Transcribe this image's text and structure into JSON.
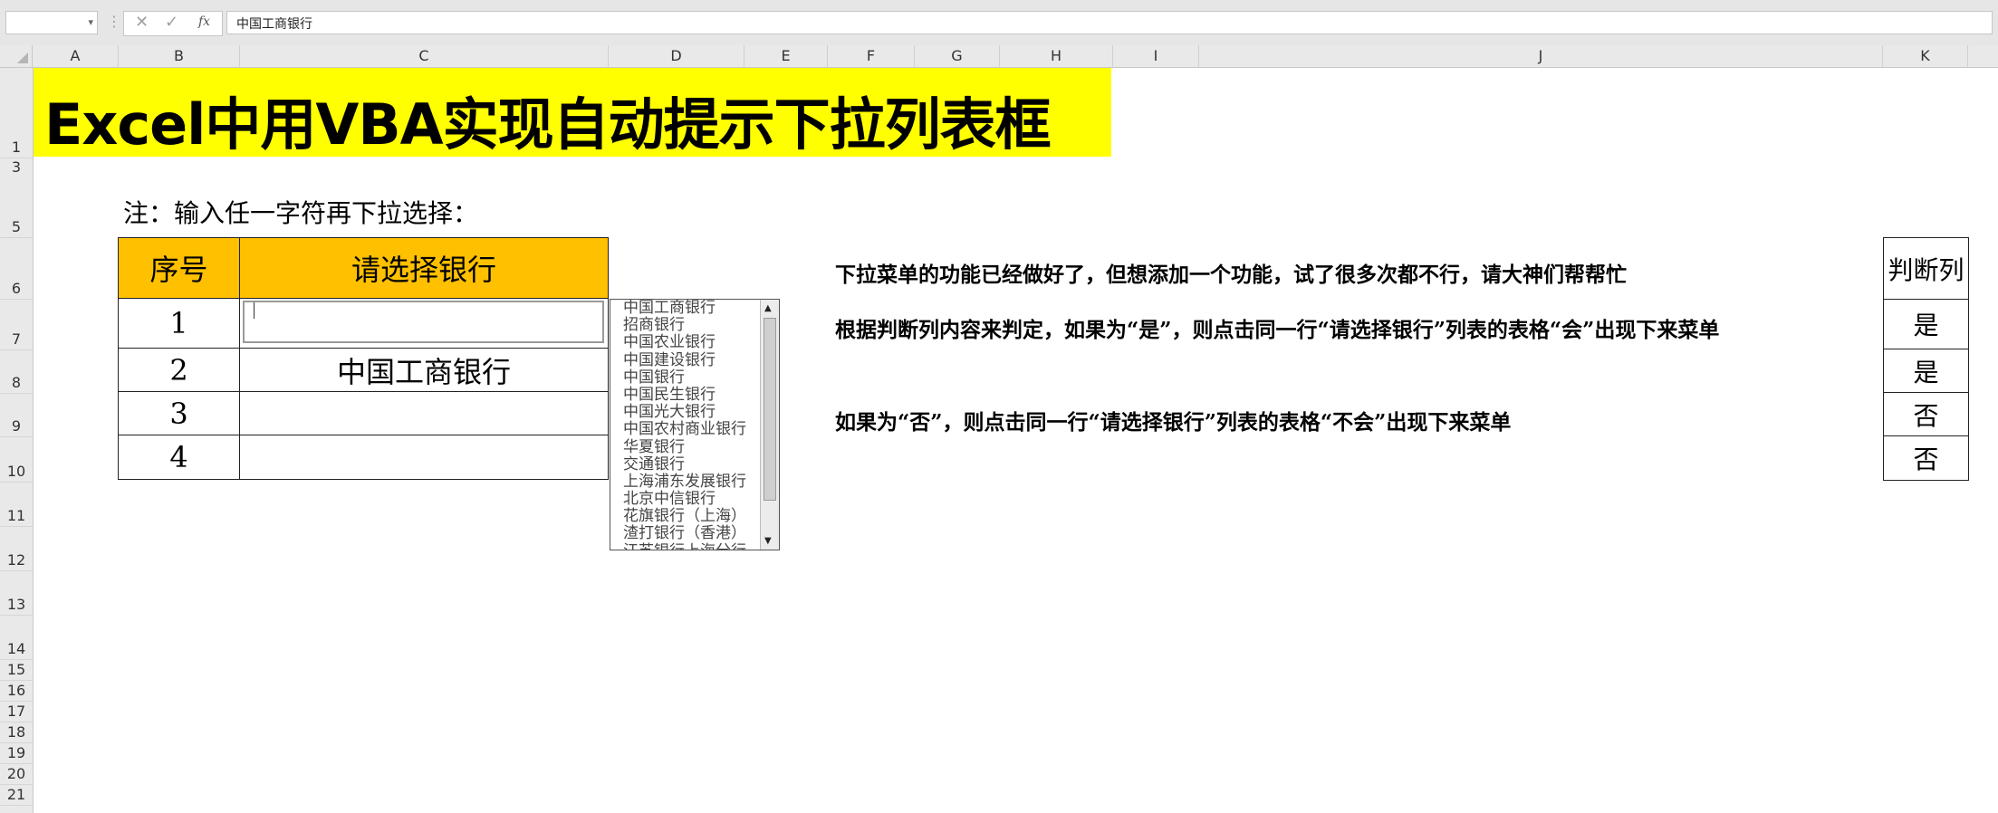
{
  "formula_bar": {
    "name_box": "",
    "fx_label": "fx",
    "formula": "中国工商银行"
  },
  "columns": [
    "A",
    "B",
    "C",
    "D",
    "E",
    "F",
    "G",
    "H",
    "I",
    "J",
    "K"
  ],
  "rows": [
    "1",
    "3",
    "5",
    "6",
    "7",
    "8",
    "9",
    "10",
    "11",
    "12",
    "13",
    "14",
    "15",
    "16",
    "17",
    "18",
    "19",
    "20",
    "21"
  ],
  "sheet": {
    "title": "Excel中用VBA实现自动提示下拉列表框",
    "note": "注：输入任一字符再下拉选择：",
    "table": {
      "header_num": "序号",
      "header_bank": "请选择银行",
      "rows": [
        {
          "num": "1",
          "bank": ""
        },
        {
          "num": "2",
          "bank": "中国工商银行"
        },
        {
          "num": "3",
          "bank": ""
        },
        {
          "num": "4",
          "bank": ""
        }
      ]
    },
    "dropdown_items": [
      "中国工商银行",
      "招商银行",
      "中国农业银行",
      "中国建设银行",
      "中国银行",
      "中国民生银行",
      "中国光大银行",
      "中国农村商业银行",
      "华夏银行",
      "交通银行",
      "上海浦东发展银行",
      "北京中信银行",
      "花旗银行（上海）",
      "渣打银行（香港）",
      "江苏银行上海分行"
    ],
    "description": {
      "line1": "下拉菜单的功能已经做好了，但想添加一个功能，试了很多次都不行，请大神们帮帮忙",
      "line2": "根据判断列内容来判定，如果为“是”，则点击同一行“请选择银行”列表的表格“会”出现下来菜单",
      "line3": "如果为“否”，则点击同一行“请选择银行”列表的表格“不会”出现下来菜单"
    },
    "judge": {
      "header": "判断列",
      "values": [
        "是",
        "是",
        "否",
        "否"
      ]
    }
  },
  "colors": {
    "title_bg": "#ffff00",
    "header_bg": "#ffc000"
  }
}
